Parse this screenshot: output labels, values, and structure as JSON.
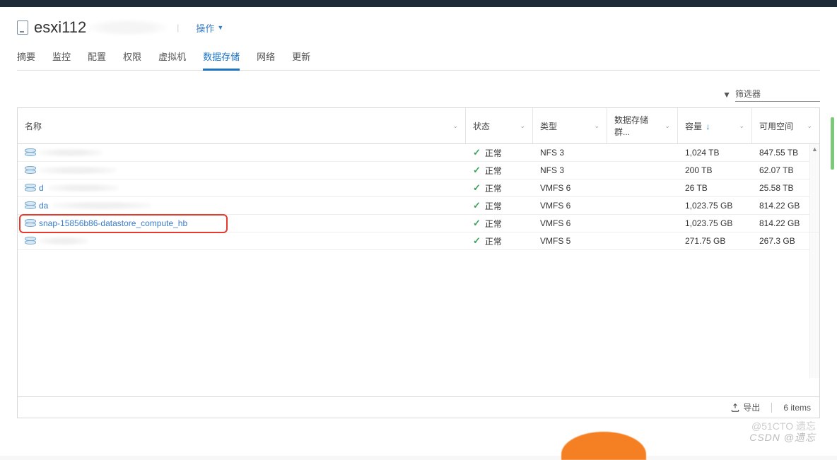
{
  "header": {
    "host_name": "esxi112",
    "actions_label": "操作"
  },
  "tabs": [
    {
      "label": "摘要",
      "active": false
    },
    {
      "label": "监控",
      "active": false
    },
    {
      "label": "配置",
      "active": false
    },
    {
      "label": "权限",
      "active": false
    },
    {
      "label": "虚拟机",
      "active": false
    },
    {
      "label": "数据存储",
      "active": true
    },
    {
      "label": "网络",
      "active": false
    },
    {
      "label": "更新",
      "active": false
    }
  ],
  "filter": {
    "label": "筛选器"
  },
  "columns": {
    "name": "名称",
    "status": "状态",
    "type": "类型",
    "cluster": "数据存储群...",
    "capacity": "容量",
    "free": "可用空间"
  },
  "rows": [
    {
      "name_hidden": true,
      "name": "",
      "status": "正常",
      "type": "NFS 3",
      "capacity": "1,024 TB",
      "free": "847.55 TB",
      "highlighted": false
    },
    {
      "name_hidden": true,
      "name": "",
      "status": "正常",
      "type": "NFS 3",
      "capacity": "200 TB",
      "free": "62.07 TB",
      "highlighted": false
    },
    {
      "name_hidden": true,
      "name": "d",
      "status": "正常",
      "type": "VMFS 6",
      "capacity": "26 TB",
      "free": "25.58 TB",
      "highlighted": false
    },
    {
      "name_hidden": true,
      "name": "da",
      "status": "正常",
      "type": "VMFS 6",
      "capacity": "1,023.75 GB",
      "free": "814.22 GB",
      "highlighted": false
    },
    {
      "name_hidden": false,
      "name": "snap-15856b86-datastore_compute_hb",
      "status": "正常",
      "type": "VMFS 6",
      "capacity": "1,023.75 GB",
      "free": "814.22 GB",
      "highlighted": true
    },
    {
      "name_hidden": true,
      "name": "",
      "status": "正常",
      "type": "VMFS 5",
      "capacity": "271.75 GB",
      "free": "267.3 GB",
      "highlighted": false
    }
  ],
  "footer": {
    "export_label": "导出",
    "count_label": "6 items"
  },
  "watermarks": {
    "w1": "CSDN @遗忘",
    "w2": "@51CTO 遗忘"
  }
}
